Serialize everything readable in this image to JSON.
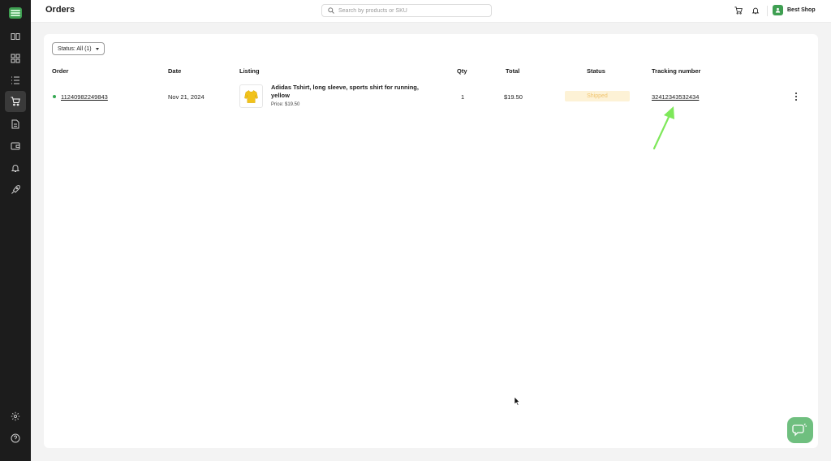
{
  "header": {
    "title": "Orders",
    "search_placeholder": "Search by products or SKU",
    "shop_name": "Best Shop"
  },
  "filter": {
    "label": "Status: All (1)"
  },
  "table": {
    "columns": [
      "Order",
      "Date",
      "Listing",
      "Qty",
      "Total",
      "Status",
      "Tracking number"
    ],
    "rows": [
      {
        "order": "11240982249843",
        "date": "Nov 21, 2024",
        "listing_title": "Adidas Tshirt, long sleeve, sports shirt for running, yellow",
        "listing_price": "Price: $19.50",
        "qty": "1",
        "total": "$19.50",
        "status": "Shipped",
        "tracking": "32412343532434"
      }
    ]
  },
  "sidebar": {
    "items": [
      "logo-icon",
      "catalog-icon",
      "dashboard-icon",
      "list-icon",
      "cart-icon",
      "document-icon",
      "wallet-icon",
      "bell-icon",
      "rocket-icon",
      "settings-icon",
      "help-icon"
    ],
    "active": "cart-icon"
  },
  "colors": {
    "sidebar": "#1c1c1c",
    "brand_green": "#3f9f52",
    "status_shipped_bg": "#fdf2d6",
    "status_shipped_text": "#f0c46e",
    "annotation_arrow": "#7ee85a"
  }
}
